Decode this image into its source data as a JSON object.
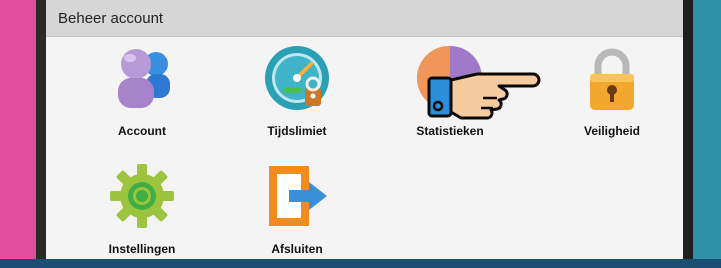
{
  "window": {
    "title": "Beheer account"
  },
  "tiles": [
    {
      "label": "Account",
      "icon": "user-accounts-icon"
    },
    {
      "label": "Tijdslimiet",
      "icon": "timer-gauge-icon"
    },
    {
      "label": "Statistieken",
      "icon": "pie-chart-icon"
    },
    {
      "label": "Veiligheid",
      "icon": "padlock-icon"
    },
    {
      "label": "Instellingen",
      "icon": "gear-icon"
    },
    {
      "label": "Afsluiten",
      "icon": "exit-door-icon"
    }
  ],
  "overlay": {
    "icon": "pointing-hand-icon"
  }
}
